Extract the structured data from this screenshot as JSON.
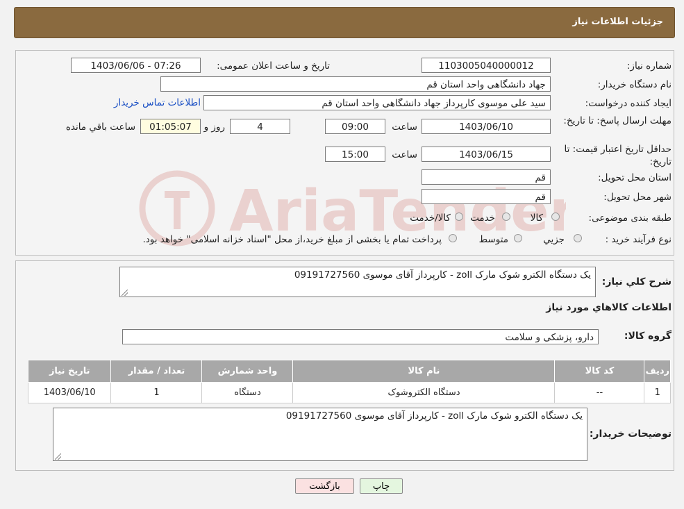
{
  "header": {
    "title": "جزئیات اطلاعات نیاز"
  },
  "labels": {
    "need_number": "شماره نیاز:",
    "announce_datetime": "تاریخ و ساعت اعلان عمومی:",
    "buyer_org": "نام دستگاه خریدار:",
    "requester": "ایجاد کننده درخواست:",
    "reply_deadline": "مهلت ارسال پاسخ: تا تاریخ:",
    "time": "ساعت",
    "day_and": "روز و",
    "remaining": "ساعت باقي مانده",
    "price_validity": "حداقل تاریخ اعتبار قیمت: تا تاریخ:",
    "province": "استان محل تحویل:",
    "city": "شهر محل تحویل:",
    "category": "طبقه بندی موضوعی:",
    "purchase_type": "نوع فرآیند خرید :"
  },
  "values": {
    "need_number": "1103005040000012",
    "announce_datetime": "1403/06/06 - 07:26",
    "buyer_org": "جهاد دانشگاهی واحد استان قم",
    "requester": "سید علی موسوی کارپرداز جهاد دانشگاهی واحد استان قم",
    "contact_link": "اطلاعات تماس خریدار",
    "reply_date": "1403/06/10",
    "reply_time": "09:00",
    "days": "4",
    "remaining_time": "01:05:07",
    "validity_date": "1403/06/15",
    "validity_time": "15:00",
    "province": "قم",
    "city": "قم"
  },
  "category_options": [
    "کالا",
    "خدمت",
    "کالا/خدمت"
  ],
  "purchase_options": [
    "جزیي",
    "متوسط"
  ],
  "purchase_note": "پرداخت تمام یا بخشی از مبلغ خرید،از محل \"اسناد خزانه اسلامی\" خواهد بود.",
  "section2": {
    "summary_label": "شرح کلي نياز:",
    "summary_text": "یک دستگاه الکترو شوک مارک zoll  -  کارپرداز آقای موسوی 09191727560",
    "goods_info_title": "اطلاعات کالاهاي مورد نياز",
    "goods_group_label": "گروه کالا:",
    "goods_group_value": "دارو، پزشکی و سلامت",
    "table_headers": [
      "رديف",
      "کد کالا",
      "نام کالا",
      "واحد شمارش",
      "تعداد / مقدار",
      "تاریخ نیاز"
    ],
    "table_rows": [
      [
        "1",
        "--",
        "دستگاه الکتروشوک",
        "دستگاه",
        "1",
        "1403/06/10"
      ]
    ],
    "buyer_notes_label": "توضیحات خریدار:",
    "buyer_notes_text": "یک دستگاه الکترو شوک مارک zoll  -  کارپرداز آقای موسوی 09191727560"
  },
  "buttons": {
    "print": "چاپ",
    "back": "بازگشت"
  },
  "watermark": {
    "text": "AriaTender.neT"
  },
  "colors": {
    "header_bg": "#8a6a3f",
    "table_header_bg": "#a8a8a8",
    "link": "#1a4fc4",
    "back_button_bg": "#fbe1e1",
    "print_button_bg": "#e4f6df"
  }
}
